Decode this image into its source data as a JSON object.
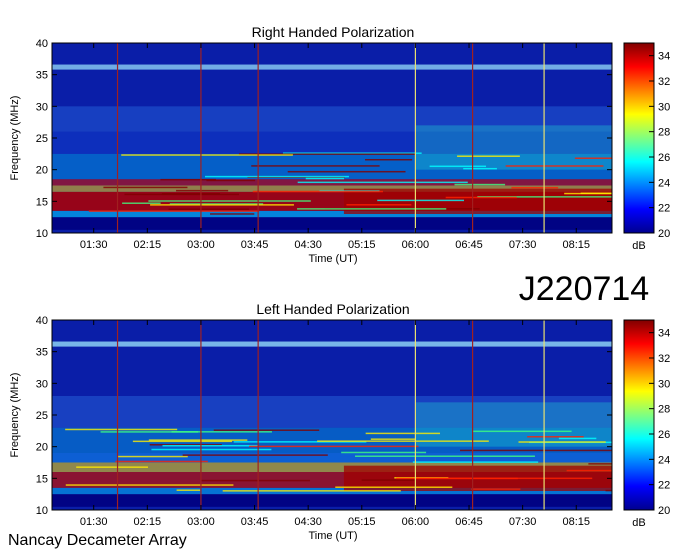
{
  "page": {
    "identifier": "J220714",
    "instrument": "Nancay Decameter Array"
  },
  "colorbar": {
    "unit": "dB",
    "min": 20,
    "max": 35,
    "ticks": [
      "20",
      "22",
      "24",
      "26",
      "28",
      "30",
      "32",
      "34"
    ],
    "colors": [
      "#00008f",
      "#0000ff",
      "#0080ff",
      "#00ffff",
      "#80ff80",
      "#ffff00",
      "#ff8000",
      "#ff0000",
      "#800000"
    ]
  },
  "chart_data": [
    {
      "type": "heatmap",
      "title": "Right Handed Polarization",
      "xlabel": "Time (UT)",
      "ylabel": "Frequency (MHz)",
      "xlim": [
        "00:55",
        "08:45"
      ],
      "ylim": [
        10,
        40
      ],
      "x_ticks": [
        "01:30",
        "02:15",
        "03:00",
        "03:45",
        "04:30",
        "05:15",
        "06:00",
        "06:45",
        "07:30",
        "08:15"
      ],
      "y_ticks": [
        "10",
        "15",
        "20",
        "25",
        "30",
        "35",
        "40"
      ],
      "z_unit": "dB",
      "z_range": [
        20,
        35
      ]
    },
    {
      "type": "heatmap",
      "title": "Left Handed Polarization",
      "xlabel": "Time (UT)",
      "ylabel": "Frequency (MHz)",
      "xlim": [
        "00:55",
        "08:45"
      ],
      "ylim": [
        10,
        40
      ],
      "x_ticks": [
        "01:30",
        "02:15",
        "03:00",
        "03:45",
        "04:30",
        "05:15",
        "06:00",
        "06:45",
        "07:30",
        "08:15"
      ],
      "y_ticks": [
        "10",
        "15",
        "20",
        "25",
        "30",
        "35",
        "40"
      ],
      "z_unit": "dB",
      "z_range": [
        20,
        35
      ]
    }
  ]
}
